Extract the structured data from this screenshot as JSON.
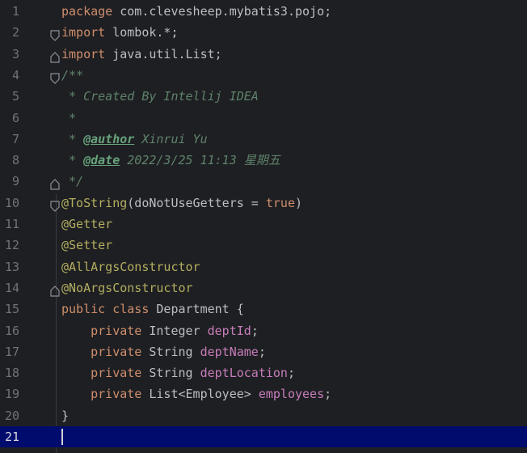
{
  "editor": {
    "active_line": 21,
    "lines": [
      {
        "n": "1",
        "segments": [
          {
            "t": "package ",
            "c": "kw"
          },
          {
            "t": "com.clevesheep.mybatis3.pojo;",
            "c": "df"
          }
        ]
      },
      {
        "n": "2",
        "segments": [
          {
            "t": "import ",
            "c": "kw"
          },
          {
            "t": "lombok.*;",
            "c": "df"
          }
        ]
      },
      {
        "n": "3",
        "segments": [
          {
            "t": "import ",
            "c": "kw"
          },
          {
            "t": "java.util.List;",
            "c": "df"
          }
        ]
      },
      {
        "n": "4",
        "segments": [
          {
            "t": "/**",
            "c": "cm"
          }
        ]
      },
      {
        "n": "5",
        "segments": [
          {
            "t": " * Created By Intellij IDEA",
            "c": "cm"
          }
        ]
      },
      {
        "n": "6",
        "segments": [
          {
            "t": " *",
            "c": "cm"
          }
        ]
      },
      {
        "n": "7",
        "segments": [
          {
            "t": " * ",
            "c": "cm"
          },
          {
            "t": "@author",
            "c": "tg"
          },
          {
            "t": " Xinrui Yu",
            "c": "cp"
          }
        ]
      },
      {
        "n": "8",
        "segments": [
          {
            "t": " * ",
            "c": "cm"
          },
          {
            "t": "@date",
            "c": "tg"
          },
          {
            "t": " 2022/3/25 11:13 星期五",
            "c": "cp"
          }
        ]
      },
      {
        "n": "9",
        "segments": [
          {
            "t": " */",
            "c": "cm"
          }
        ]
      },
      {
        "n": "10",
        "segments": [
          {
            "t": "@ToString",
            "c": "an"
          },
          {
            "t": "(doNotUseGetters = ",
            "c": "df"
          },
          {
            "t": "true",
            "c": "kw"
          },
          {
            "t": ")",
            "c": "df"
          }
        ]
      },
      {
        "n": "11",
        "segments": [
          {
            "t": "@Getter",
            "c": "an"
          }
        ]
      },
      {
        "n": "12",
        "segments": [
          {
            "t": "@Setter",
            "c": "an"
          }
        ]
      },
      {
        "n": "13",
        "segments": [
          {
            "t": "@AllArgsConstructor",
            "c": "an"
          }
        ]
      },
      {
        "n": "14",
        "segments": [
          {
            "t": "@NoArgsConstructor",
            "c": "an"
          }
        ]
      },
      {
        "n": "15",
        "segments": [
          {
            "t": "public class ",
            "c": "kw"
          },
          {
            "t": "Department {",
            "c": "df"
          }
        ]
      },
      {
        "n": "16",
        "segments": [
          {
            "t": "    private ",
            "c": "kw"
          },
          {
            "t": "Integer ",
            "c": "df"
          },
          {
            "t": "deptId",
            "c": "fd"
          },
          {
            "t": ";",
            "c": "df"
          }
        ]
      },
      {
        "n": "17",
        "segments": [
          {
            "t": "    private ",
            "c": "kw"
          },
          {
            "t": "String ",
            "c": "df"
          },
          {
            "t": "deptName",
            "c": "fd"
          },
          {
            "t": ";",
            "c": "df"
          }
        ]
      },
      {
        "n": "18",
        "segments": [
          {
            "t": "    private ",
            "c": "kw"
          },
          {
            "t": "String ",
            "c": "df"
          },
          {
            "t": "deptLocation",
            "c": "fd"
          },
          {
            "t": ";",
            "c": "df"
          }
        ]
      },
      {
        "n": "19",
        "segments": [
          {
            "t": "    private ",
            "c": "kw"
          },
          {
            "t": "List<Employee> ",
            "c": "df"
          },
          {
            "t": "employees",
            "c": "fd"
          },
          {
            "t": ";",
            "c": "df"
          }
        ]
      },
      {
        "n": "20",
        "segments": [
          {
            "t": "}",
            "c": "df"
          }
        ]
      },
      {
        "n": "21",
        "segments": []
      }
    ]
  }
}
